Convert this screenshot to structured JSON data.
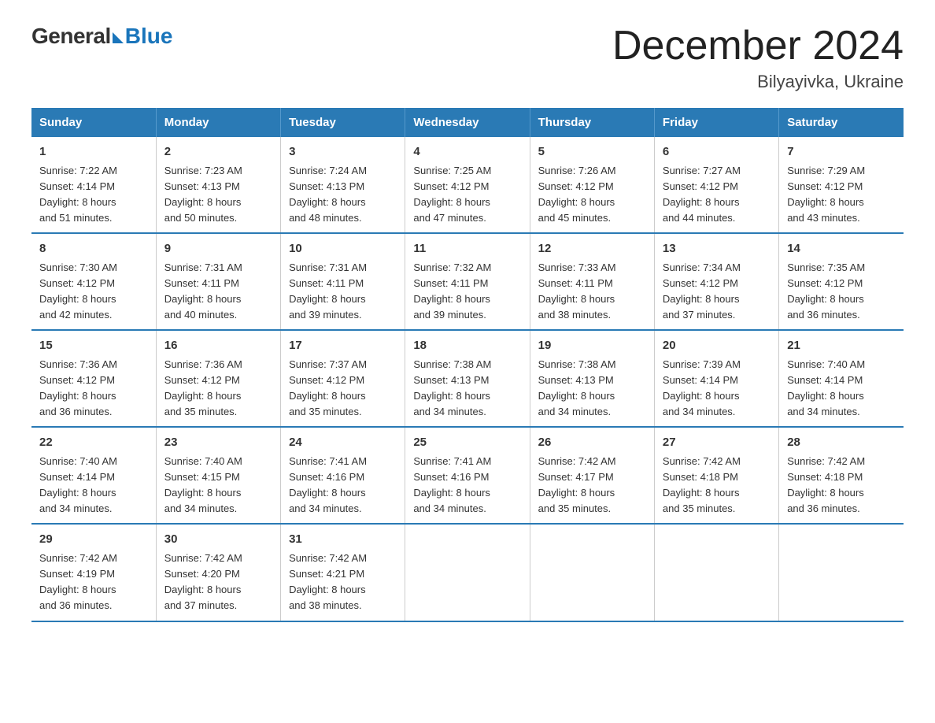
{
  "logo": {
    "general": "General",
    "blue": "Blue"
  },
  "header": {
    "month": "December 2024",
    "location": "Bilyayivka, Ukraine"
  },
  "days_of_week": [
    "Sunday",
    "Monday",
    "Tuesday",
    "Wednesday",
    "Thursday",
    "Friday",
    "Saturday"
  ],
  "weeks": [
    [
      {
        "day": "1",
        "sunrise": "7:22 AM",
        "sunset": "4:14 PM",
        "daylight": "8 hours and 51 minutes."
      },
      {
        "day": "2",
        "sunrise": "7:23 AM",
        "sunset": "4:13 PM",
        "daylight": "8 hours and 50 minutes."
      },
      {
        "day": "3",
        "sunrise": "7:24 AM",
        "sunset": "4:13 PM",
        "daylight": "8 hours and 48 minutes."
      },
      {
        "day": "4",
        "sunrise": "7:25 AM",
        "sunset": "4:12 PM",
        "daylight": "8 hours and 47 minutes."
      },
      {
        "day": "5",
        "sunrise": "7:26 AM",
        "sunset": "4:12 PM",
        "daylight": "8 hours and 45 minutes."
      },
      {
        "day": "6",
        "sunrise": "7:27 AM",
        "sunset": "4:12 PM",
        "daylight": "8 hours and 44 minutes."
      },
      {
        "day": "7",
        "sunrise": "7:29 AM",
        "sunset": "4:12 PM",
        "daylight": "8 hours and 43 minutes."
      }
    ],
    [
      {
        "day": "8",
        "sunrise": "7:30 AM",
        "sunset": "4:12 PM",
        "daylight": "8 hours and 42 minutes."
      },
      {
        "day": "9",
        "sunrise": "7:31 AM",
        "sunset": "4:11 PM",
        "daylight": "8 hours and 40 minutes."
      },
      {
        "day": "10",
        "sunrise": "7:31 AM",
        "sunset": "4:11 PM",
        "daylight": "8 hours and 39 minutes."
      },
      {
        "day": "11",
        "sunrise": "7:32 AM",
        "sunset": "4:11 PM",
        "daylight": "8 hours and 39 minutes."
      },
      {
        "day": "12",
        "sunrise": "7:33 AM",
        "sunset": "4:11 PM",
        "daylight": "8 hours and 38 minutes."
      },
      {
        "day": "13",
        "sunrise": "7:34 AM",
        "sunset": "4:12 PM",
        "daylight": "8 hours and 37 minutes."
      },
      {
        "day": "14",
        "sunrise": "7:35 AM",
        "sunset": "4:12 PM",
        "daylight": "8 hours and 36 minutes."
      }
    ],
    [
      {
        "day": "15",
        "sunrise": "7:36 AM",
        "sunset": "4:12 PM",
        "daylight": "8 hours and 36 minutes."
      },
      {
        "day": "16",
        "sunrise": "7:36 AM",
        "sunset": "4:12 PM",
        "daylight": "8 hours and 35 minutes."
      },
      {
        "day": "17",
        "sunrise": "7:37 AM",
        "sunset": "4:12 PM",
        "daylight": "8 hours and 35 minutes."
      },
      {
        "day": "18",
        "sunrise": "7:38 AM",
        "sunset": "4:13 PM",
        "daylight": "8 hours and 34 minutes."
      },
      {
        "day": "19",
        "sunrise": "7:38 AM",
        "sunset": "4:13 PM",
        "daylight": "8 hours and 34 minutes."
      },
      {
        "day": "20",
        "sunrise": "7:39 AM",
        "sunset": "4:14 PM",
        "daylight": "8 hours and 34 minutes."
      },
      {
        "day": "21",
        "sunrise": "7:40 AM",
        "sunset": "4:14 PM",
        "daylight": "8 hours and 34 minutes."
      }
    ],
    [
      {
        "day": "22",
        "sunrise": "7:40 AM",
        "sunset": "4:14 PM",
        "daylight": "8 hours and 34 minutes."
      },
      {
        "day": "23",
        "sunrise": "7:40 AM",
        "sunset": "4:15 PM",
        "daylight": "8 hours and 34 minutes."
      },
      {
        "day": "24",
        "sunrise": "7:41 AM",
        "sunset": "4:16 PM",
        "daylight": "8 hours and 34 minutes."
      },
      {
        "day": "25",
        "sunrise": "7:41 AM",
        "sunset": "4:16 PM",
        "daylight": "8 hours and 34 minutes."
      },
      {
        "day": "26",
        "sunrise": "7:42 AM",
        "sunset": "4:17 PM",
        "daylight": "8 hours and 35 minutes."
      },
      {
        "day": "27",
        "sunrise": "7:42 AM",
        "sunset": "4:18 PM",
        "daylight": "8 hours and 35 minutes."
      },
      {
        "day": "28",
        "sunrise": "7:42 AM",
        "sunset": "4:18 PM",
        "daylight": "8 hours and 36 minutes."
      }
    ],
    [
      {
        "day": "29",
        "sunrise": "7:42 AM",
        "sunset": "4:19 PM",
        "daylight": "8 hours and 36 minutes."
      },
      {
        "day": "30",
        "sunrise": "7:42 AM",
        "sunset": "4:20 PM",
        "daylight": "8 hours and 37 minutes."
      },
      {
        "day": "31",
        "sunrise": "7:42 AM",
        "sunset": "4:21 PM",
        "daylight": "8 hours and 38 minutes."
      },
      null,
      null,
      null,
      null
    ]
  ],
  "labels": {
    "sunrise": "Sunrise:",
    "sunset": "Sunset:",
    "daylight": "Daylight:"
  }
}
